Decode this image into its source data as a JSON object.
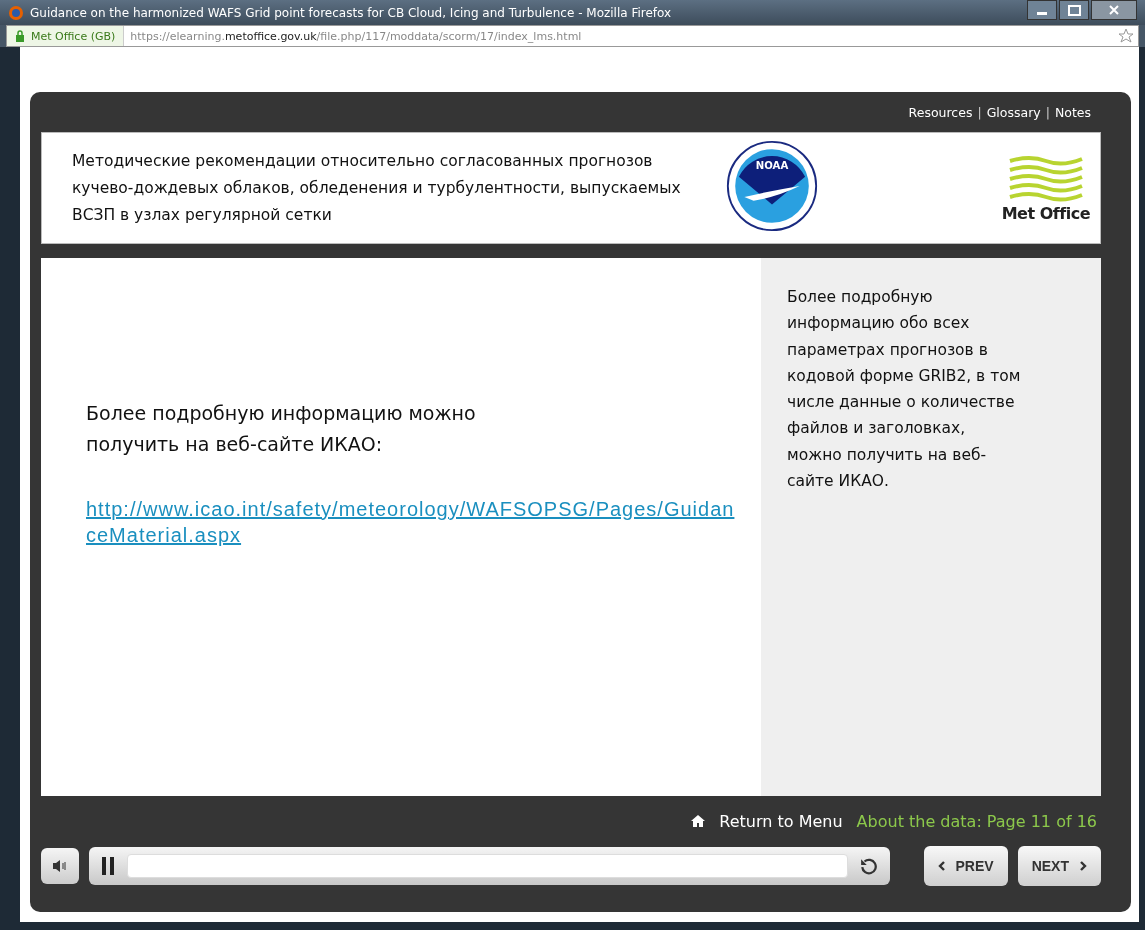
{
  "window": {
    "title": "Guidance on the harmonized WAFS Grid point forecasts for CB Cloud, Icing and Turbulence - Mozilla Firefox"
  },
  "address_bar": {
    "site_identity": "Met Office (GB)",
    "url": "https://elearning.**metoffice.gov.uk**/file.php/117/moddata/scorm/17/index_lms.html"
  },
  "top_links": [
    {
      "kind": "link",
      "label": "Resources"
    },
    {
      "kind": "separator",
      "label": "|"
    },
    {
      "kind": "link",
      "label": "Glossary"
    },
    {
      "kind": "separator",
      "label": "|"
    },
    {
      "kind": "link",
      "label": "Notes"
    }
  ],
  "header": {
    "title": "Методические рекомендации относительно согласованных прогнозов кучево-дождевых облаков, обледенения и турбулентности, выпускаемых ВСЗП в узлах регулярной сетки",
    "noaa_logo_text": "NOAA",
    "metoffice_logo_text": "Met Office"
  },
  "content": {
    "text": "Более подробную информацию можно получить на веб-сайте ИКАО:",
    "link": "http://www.icao.int/safety/meteorology/WAFSOPSG/Pages/GuidanceMaterial.aspx"
  },
  "sidebar": {
    "text": "Более подробную информацию обо всех параметрах прогнозов в кодовой форме GRIB2, в том числе данные о количестве файлов и заголовках, можно получить на веб-сайте ИКАО."
  },
  "footer": {
    "return_link": "Return to Menu",
    "page_info": "About the data: Page 11 of 16"
  },
  "player": {
    "prev": "PREV",
    "next": "NEXT"
  }
}
